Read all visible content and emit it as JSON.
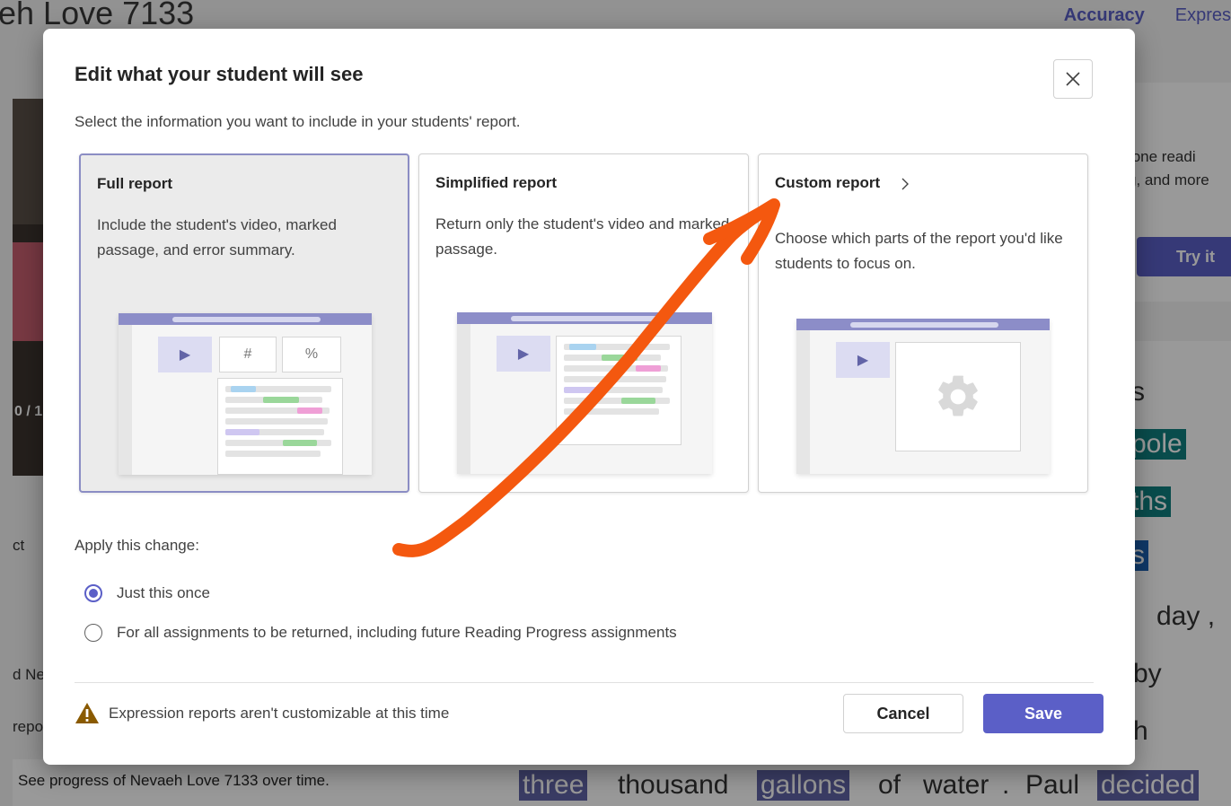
{
  "background": {
    "page_title": "eh Love 7133",
    "tabs": [
      "Accuracy",
      "Expres"
    ],
    "video_time": "0 / 1",
    "left_labels": [
      "ct",
      "d Ne",
      "repo"
    ],
    "progress_text": "See progress of Nevaeh Love 7133 over time.",
    "promo": {
      "text_line1": "tone readi",
      "text_line2": "g, and more",
      "button": "Try it"
    },
    "reading": {
      "words": [
        "s",
        "pole",
        "ths",
        "s",
        "day ,",
        "by",
        "h"
      ],
      "bottom_line": [
        "three",
        "thousand",
        "gallons",
        "of",
        "water",
        ".",
        "Paul",
        "decided"
      ]
    }
  },
  "dialog": {
    "title": "Edit what your student will see",
    "subtitle": "Select the information you want to include in your students' report.",
    "close_label": "Close",
    "cards": [
      {
        "title": "Full report",
        "description": "Include the student's video, marked passage, and error summary.",
        "selected": true,
        "tile_hash": "#",
        "tile_percent": "%"
      },
      {
        "title": "Simplified report",
        "description": "Return only the student's video and marked passage.",
        "selected": false
      },
      {
        "title": "Custom report",
        "description": "Choose which parts of the report you'd like students to focus on.",
        "selected": false
      }
    ],
    "apply_label": "Apply this change:",
    "options": [
      {
        "label": "Just this once",
        "checked": true
      },
      {
        "label": "For all assignments to be returned, including future Reading Progress assignments",
        "checked": false
      }
    ],
    "warning": "Expression reports aren't customizable at this time",
    "cancel_label": "Cancel",
    "save_label": "Save"
  },
  "colors": {
    "accent": "#5b5fc7",
    "annotation_arrow": "#f4580f",
    "highlight_teal": "#0f7f7f",
    "highlight_purple": "#6264a7",
    "warning": "#8a5a00"
  }
}
